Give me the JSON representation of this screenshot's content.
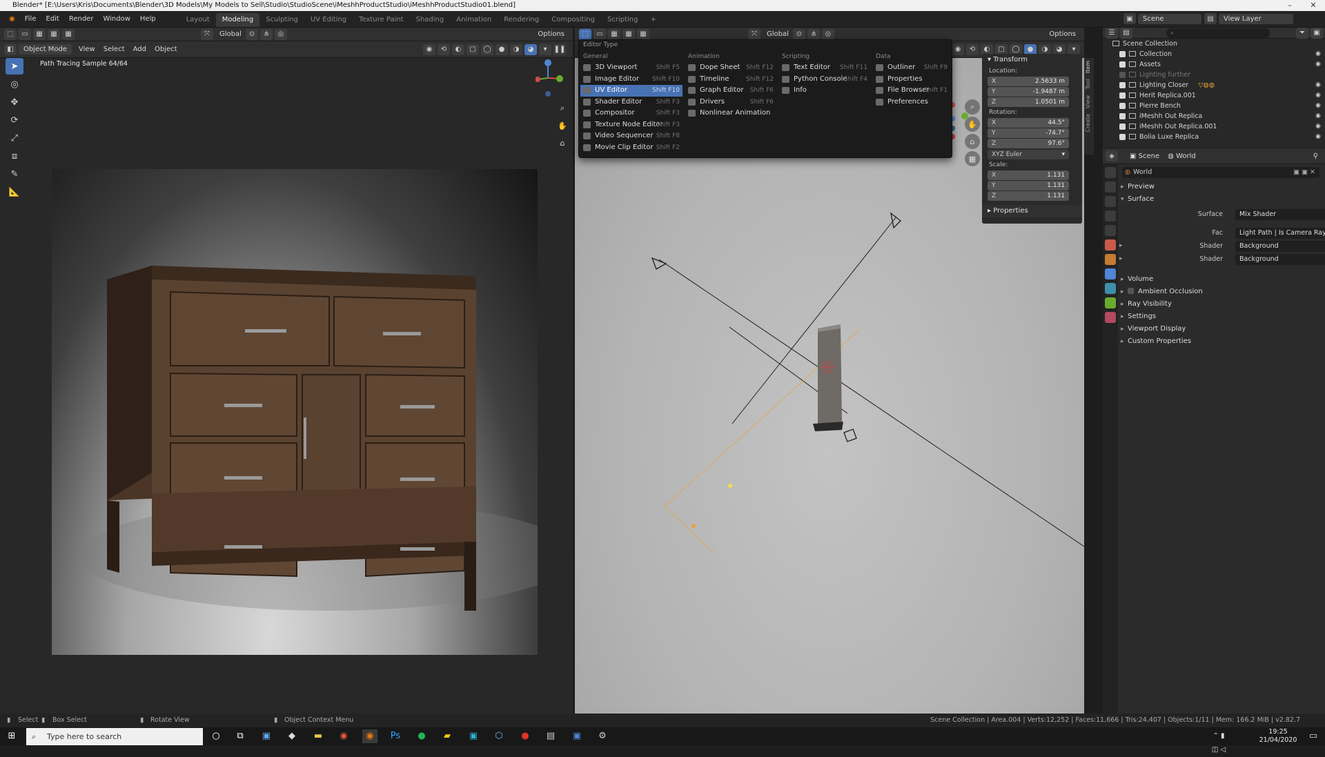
{
  "window": {
    "title": "Blender* [E:\\Users\\Kris\\Documents\\Blender\\3D Models\\My Models to Sell\\Studio\\StudioScene\\iMeshhProductStudio\\iMeshhProductStudio01.blend]"
  },
  "menu": [
    "File",
    "Edit",
    "Render",
    "Window",
    "Help"
  ],
  "workspaces": [
    {
      "label": "Layout"
    },
    {
      "label": "Modeling",
      "active": true
    },
    {
      "label": "Sculpting"
    },
    {
      "label": "UV Editing"
    },
    {
      "label": "Texture Paint"
    },
    {
      "label": "Shading"
    },
    {
      "label": "Animation"
    },
    {
      "label": "Rendering"
    },
    {
      "label": "Compositing"
    },
    {
      "label": "Scripting"
    }
  ],
  "topright": {
    "scene_label": "Scene",
    "view_layer_label": "View Layer"
  },
  "left_header": {
    "mode": "Object Mode",
    "menus": [
      "View",
      "Select",
      "Add",
      "Object"
    ],
    "transform_orientation": "Global",
    "options": "Options"
  },
  "left_view": {
    "overlay_text": "Path Tracing Sample 64/64"
  },
  "right_header": {
    "transform_orientation": "Global",
    "options": "Options"
  },
  "editor_popup": {
    "title": "Editor Type",
    "columns": [
      {
        "heading": "General",
        "items": [
          {
            "label": "3D Viewport",
            "shortcut": "Shift F5"
          },
          {
            "label": "Image Editor",
            "shortcut": "Shift F10"
          },
          {
            "label": "UV Editor",
            "shortcut": "Shift F10",
            "highlight": true
          },
          {
            "label": "Shader Editor",
            "shortcut": "Shift F3"
          },
          {
            "label": "Compositor",
            "shortcut": "Shift F3"
          },
          {
            "label": "Texture Node Editor",
            "shortcut": "Shift F3"
          },
          {
            "label": "Video Sequencer",
            "shortcut": "Shift F8"
          },
          {
            "label": "Movie Clip Editor",
            "shortcut": "Shift F2"
          }
        ]
      },
      {
        "heading": "Animation",
        "items": [
          {
            "label": "Dope Sheet",
            "shortcut": "Shift F12"
          },
          {
            "label": "Timeline",
            "shortcut": "Shift F12"
          },
          {
            "label": "Graph Editor",
            "shortcut": "Shift F6"
          },
          {
            "label": "Drivers",
            "shortcut": "Shift F6"
          },
          {
            "label": "Nonlinear Animation",
            "shortcut": ""
          }
        ]
      },
      {
        "heading": "Scripting",
        "items": [
          {
            "label": "Text Editor",
            "shortcut": "Shift F11"
          },
          {
            "label": "Python Console",
            "shortcut": "Shift F4"
          },
          {
            "label": "Info",
            "shortcut": ""
          }
        ]
      },
      {
        "heading": "Data",
        "items": [
          {
            "label": "Outliner",
            "shortcut": "Shift F9"
          },
          {
            "label": "Properties",
            "shortcut": ""
          },
          {
            "label": "File Browser",
            "shortcut": "Shift F1"
          },
          {
            "label": "Preferences",
            "shortcut": ""
          }
        ]
      }
    ]
  },
  "npanel": {
    "transform_label": "Transform",
    "location_label": "Location:",
    "location": [
      {
        "axis": "X",
        "value": "2.5633 m"
      },
      {
        "axis": "Y",
        "value": "-1.9487 m"
      },
      {
        "axis": "Z",
        "value": "1.0501 m"
      }
    ],
    "rotation_label": "Rotation:",
    "rotation": [
      {
        "axis": "X",
        "value": "44.5°"
      },
      {
        "axis": "Y",
        "value": "-74.7°"
      },
      {
        "axis": "Z",
        "value": "97.6°"
      }
    ],
    "rotation_mode": "XYZ Euler",
    "scale_label": "Scale:",
    "scale": [
      {
        "axis": "X",
        "value": "1.131"
      },
      {
        "axis": "Y",
        "value": "1.131"
      },
      {
        "axis": "Z",
        "value": "1.131"
      }
    ],
    "properties_label": "Properties",
    "tabs": [
      "Item",
      "Tool",
      "View",
      "Create"
    ]
  },
  "outliner": {
    "root": "Scene Collection",
    "rows": [
      {
        "label": "Collection",
        "dim": false
      },
      {
        "label": "Assets",
        "dim": false
      },
      {
        "label": "Lighting further",
        "dim": true
      },
      {
        "label": "Lighting Closer",
        "dim": false
      },
      {
        "label": "Herit Replica.001",
        "dim": false
      },
      {
        "label": "Pierre Bench",
        "dim": false
      },
      {
        "label": "iMeshh Out Replica",
        "dim": false
      },
      {
        "label": "iMeshh Out Replica.001",
        "dim": false
      },
      {
        "label": "Bolia Luxe Replica",
        "dim": false
      }
    ]
  },
  "properties": {
    "breadcrumb": [
      "Scene",
      "World"
    ],
    "world_name": "World",
    "sections_top": [
      {
        "label": "Preview",
        "open": false
      },
      {
        "label": "Surface",
        "open": true
      }
    ],
    "fields": [
      {
        "label": "Surface",
        "value": "Mix Shader"
      },
      {
        "label": "Fac",
        "value": "Light Path | Is Camera Ray"
      },
      {
        "label": "Shader",
        "value": "Background"
      },
      {
        "label": "Shader",
        "value": "Background"
      }
    ],
    "sections_bottom": [
      {
        "label": "Volume"
      },
      {
        "label": "Ambient Occlusion"
      },
      {
        "label": "Ray Visibility"
      },
      {
        "label": "Settings"
      },
      {
        "label": "Viewport Display"
      },
      {
        "label": "Custom Properties"
      }
    ]
  },
  "statusbar": {
    "select": "Select",
    "box_select": "Box Select",
    "rotate_view": "Rotate View",
    "context_menu": "Object Context Menu",
    "stats": "Scene Collection | Area.004 | Verts:12,252 | Faces:11,666 | Tris:24,407 | Objects:1/11 | Mem: 166.2 MiB | v2.82.7"
  },
  "taskbar": {
    "search_placeholder": "Type here to search",
    "time": "19:25",
    "date": "21/04/2020"
  },
  "colors": {
    "accent": "#4772b3",
    "light_ray": "#e8a33a"
  }
}
